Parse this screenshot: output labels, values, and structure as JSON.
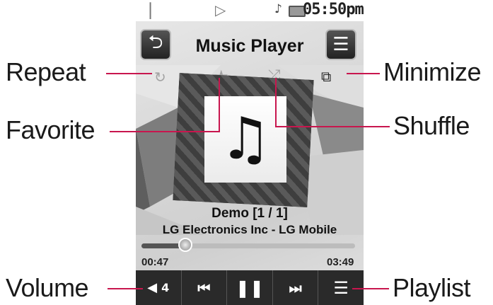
{
  "annotations": {
    "repeat": "Repeat",
    "favorite": "Favorite",
    "volume": "Volume",
    "minimize": "Minimize",
    "shuffle": "Shuffle",
    "playlist": "Playlist"
  },
  "status_bar": {
    "time": "05:50pm"
  },
  "header": {
    "title": "Music Player",
    "back_icon": "back-arrow-icon",
    "menu_icon": "menu-icon"
  },
  "toolbar": {
    "repeat_icon": "repeat-icon",
    "favorite_icon": "star-icon",
    "shuffle_icon": "shuffle-icon",
    "minimize_icon": "minimize-icon"
  },
  "track": {
    "song": "Demo [1 / 1]",
    "artist": "LG Electronics Inc - LG Mobile",
    "elapsed": "00:47",
    "total": "03:49",
    "progress": 0.205
  },
  "controls": {
    "volume_level": "4",
    "prev_icon": "previous-track-icon",
    "pause_icon": "pause-icon",
    "next_icon": "next-track-icon",
    "playlist_icon": "playlist-icon"
  },
  "colors": {
    "leader_line": "#c8164e",
    "control_bar": "#2a2a2a"
  }
}
